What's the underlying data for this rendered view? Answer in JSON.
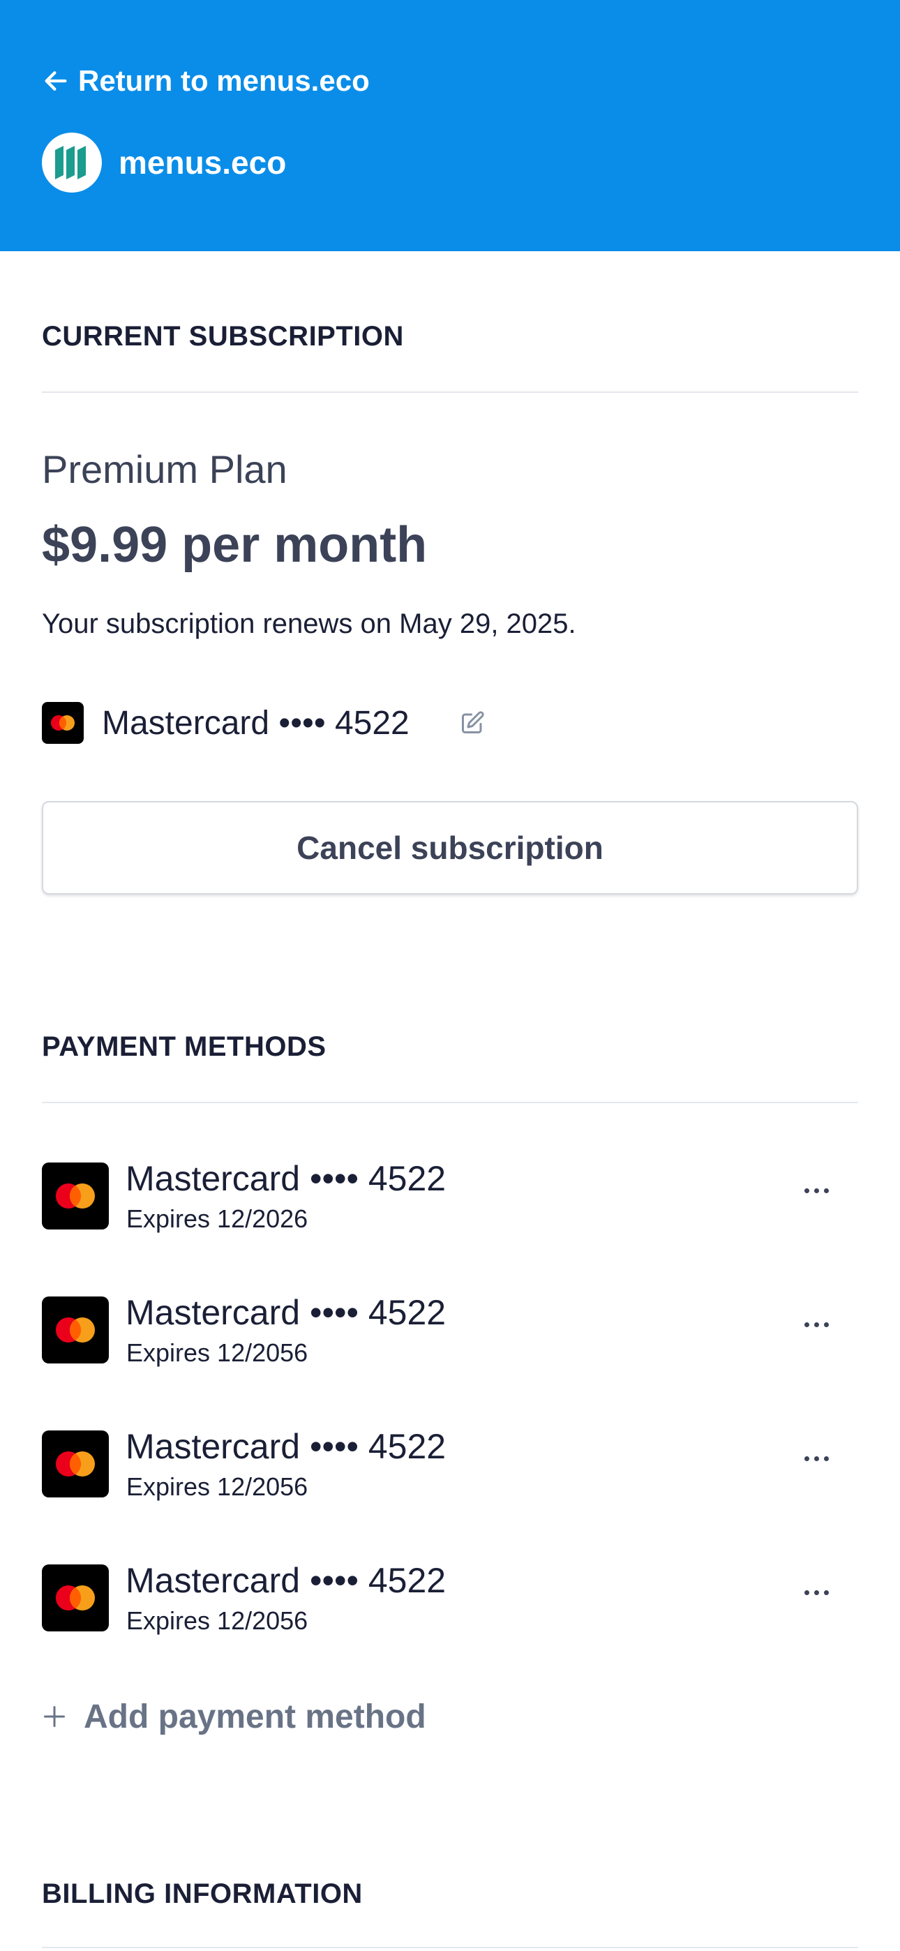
{
  "header": {
    "return_label": "Return to menus.eco",
    "brand_name": "menus.eco",
    "background_color": "#0a8de8",
    "logo_color": "#1b9c8e"
  },
  "current_subscription": {
    "section_title": "CURRENT SUBSCRIPTION",
    "plan_name": "Premium Plan",
    "price": "$9.99 per month",
    "renewal_text": "Your subscription renews on May 29, 2025.",
    "card_label": "Mastercard •••• 4522",
    "edit_icon": "pencil-edit-icon",
    "cancel_label": "Cancel subscription"
  },
  "payment_methods": {
    "section_title": "PAYMENT METHODS",
    "items": [
      {
        "label": "Mastercard •••• 4522",
        "expires": "Expires 12/2026"
      },
      {
        "label": "Mastercard •••• 4522",
        "expires": "Expires 12/2056"
      },
      {
        "label": "Mastercard •••• 4522",
        "expires": "Expires 12/2056"
      },
      {
        "label": "Mastercard •••• 4522",
        "expires": "Expires 12/2056"
      }
    ],
    "add_label": "Add payment method"
  },
  "billing_information": {
    "section_title": "BILLING INFORMATION"
  }
}
